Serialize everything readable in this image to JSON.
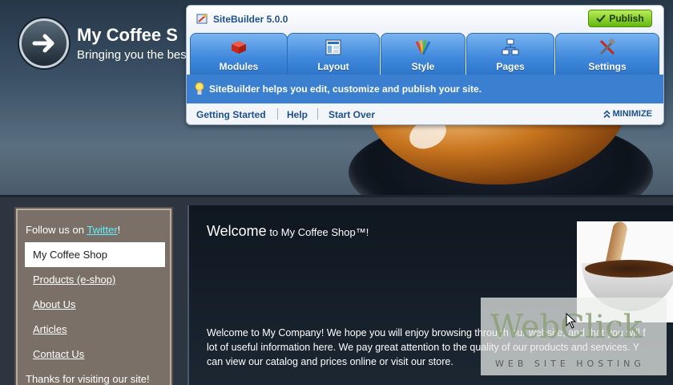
{
  "site": {
    "title": "My Coffee S",
    "tagline": "Bringing you the bes"
  },
  "sitebuilder": {
    "title": "SiteBuilder 5.0.0",
    "publish_label": "Publish",
    "tabs": [
      {
        "label": "Modules",
        "icon": "modules-icon"
      },
      {
        "label": "Layout",
        "icon": "layout-icon"
      },
      {
        "label": "Style",
        "icon": "style-icon"
      },
      {
        "label": "Pages",
        "icon": "pages-icon"
      },
      {
        "label": "Settings",
        "icon": "settings-icon"
      }
    ],
    "info_text": "SiteBuilder helps you edit, customize and publish your site.",
    "links": {
      "getting_started": "Getting Started",
      "help": "Help",
      "start_over": "Start Over",
      "minimize": "MINIMIZE"
    }
  },
  "sidebar": {
    "follow_prefix": "Follow us on ",
    "twitter": "Twitter",
    "follow_suffix": "!",
    "active_item": "My Coffee Shop",
    "items": [
      "Products (e-shop)",
      "About Us",
      "Articles",
      "Contact Us"
    ],
    "thanks": "Thanks for visiting our site!"
  },
  "content": {
    "welcome_big": "Welcome",
    "welcome_small": " to My Coffee Shop™!",
    "line1": "Welcome to My Company! We hope you will enjoy browsing through our website, and that you will f",
    "line2": "lot of useful information here. We pay great attention to the quality of our products and services. Y",
    "line3": "can view our catalog and prices online or visit our store."
  },
  "watermark": {
    "brand": "WebClick",
    "sub": "WEB SITE HOSTING"
  },
  "colors": {
    "tab_blue": "#3f88dc",
    "publish_green": "#63b80f",
    "link_cyan": "#5ef0ff"
  }
}
